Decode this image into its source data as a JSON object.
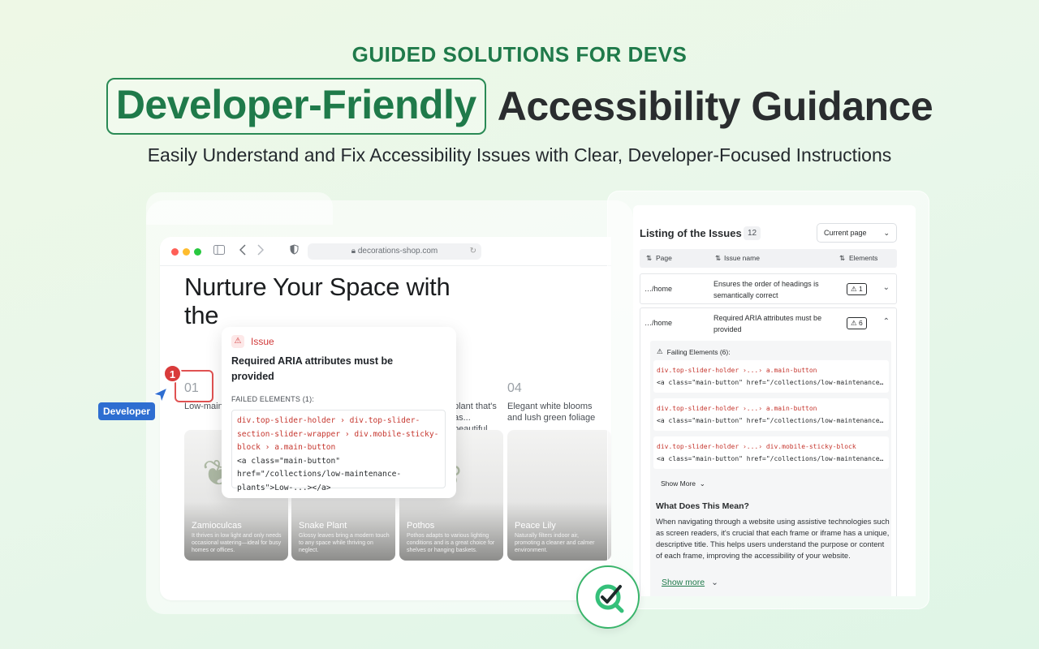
{
  "hero": {
    "eyebrow": "GUIDED SOLUTIONS FOR DEVS",
    "title_highlight": "Developer-Friendly",
    "title_rest": "Accessibility Guidance",
    "subtitle": "Easily Understand and Fix Accessibility Issues with Clear, Developer-Focused Instructions"
  },
  "browser": {
    "url": "decorations-shop.com",
    "page_heading_line1": "Nurture Your Space with",
    "page_heading_line2": "the",
    "steps": [
      {
        "num": "01",
        "text": "Low-mainte... purifying"
      },
      {
        "num": "04",
        "text": "Elegant white blooms and lush green foliage"
      }
    ],
    "step_mid_text": "plant that's as... beautiful",
    "cards": [
      {
        "title": "Zamioculcas",
        "desc": "It thrives in low light and only needs occasional watering—ideal for busy homes or offices."
      },
      {
        "title": "Snake Plant",
        "desc": "Glossy leaves bring a modern touch to any space while thriving on neglect."
      },
      {
        "title": "Pothos",
        "desc": "Pothos adapts to various lighting conditions and is a great choice for shelves or hanging baskets."
      },
      {
        "title": "Peace Lily",
        "desc": "Naturally filters indoor air, promoting a cleaner and calmer environment."
      }
    ]
  },
  "annotation": {
    "badge_count": "1",
    "developer_label": "Developer"
  },
  "issue_popup": {
    "header": "Issue",
    "title": "Required ARIA attributes must be provided",
    "failed_label": "FAILED ELEMENTS (1):",
    "selector": "div.top-slider-holder › div.top-slider-section-slider-wrapper › div.mobile-sticky-block › a.main-button",
    "html": "<a class=\"main-button\" href=\"/collections/low-maintenance-plants\">Low-...></a>"
  },
  "issues_panel": {
    "title": "Listing of the Issues",
    "count": "12",
    "filter_value": "Current page",
    "columns": [
      "Page",
      "Issue name",
      "Elements"
    ],
    "rows": [
      {
        "page": "…/home",
        "name": "Ensures the order of headings is semantically correct",
        "elements": "1",
        "expanded": false
      },
      {
        "page": "…/home",
        "name": "Required ARIA attributes must be provided",
        "elements": "6",
        "expanded": true
      }
    ],
    "failing_label": "Failing Elements (6):",
    "failing_items": [
      {
        "selector": "div.top-slider-holder ›...› a.main-button",
        "html": "<a class=\"main-button\" href=\"/collections/low-maintenance-plants\">"
      },
      {
        "selector": "div.top-slider-holder ›...› a.main-button",
        "html": "<a class=\"main-button\" href=\"/collections/low-maintenance-plants\">"
      },
      {
        "selector": "div.top-slider-holder ›...› div.mobile-sticky-block",
        "html": "<a class=\"main-button\" href=\"/collections/low-maintenance-plants\">"
      }
    ],
    "show_more_small": "Show More",
    "what_title": "What Does This Mean?",
    "what_body": "When navigating through a website using assistive technologies such as screen readers, it's crucial that each frame or iframe has a unique, descriptive title. This helps users understand the purpose or content of each frame, improving the accessibility of your website.",
    "show_more_large": "Show more"
  },
  "colors": {
    "brand_green": "#1f7a4a",
    "issue_red": "#d13a3a",
    "developer_blue": "#2e6ed1"
  },
  "icons": [
    "sidebar-toggle-icon",
    "back-arrow-icon",
    "forward-arrow-icon",
    "shield-icon",
    "lock-icon",
    "reload-icon",
    "warning-icon",
    "chevron-down-icon",
    "chevron-up-icon",
    "sort-icon",
    "cursor-arrow-icon",
    "checkmark-magnifier-logo-icon"
  ]
}
